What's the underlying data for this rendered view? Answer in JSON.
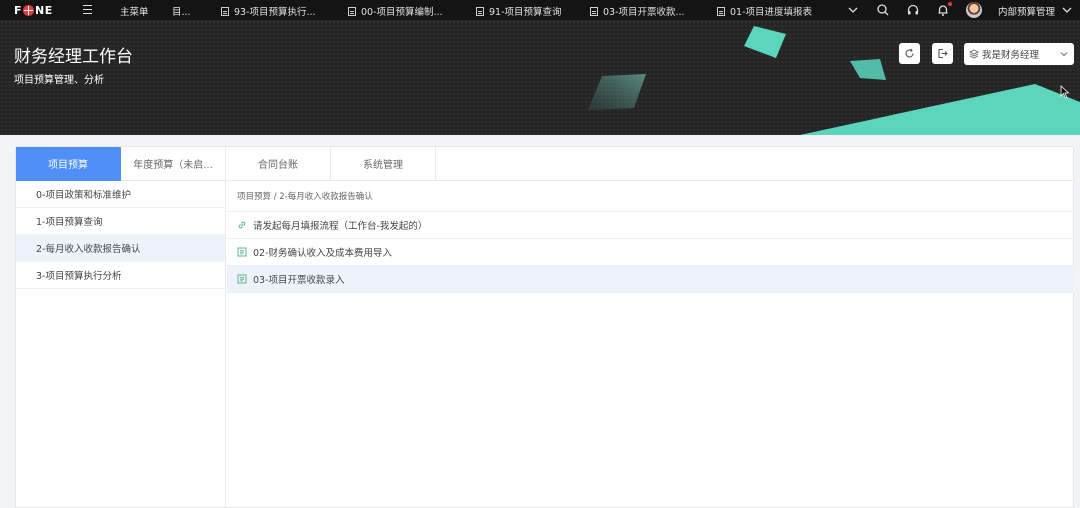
{
  "topbar": {
    "logo": [
      "F",
      "NE"
    ],
    "main_menu": "主菜单",
    "truncated_menu": "目...",
    "tabs": [
      {
        "label": "93-项目预算执行..."
      },
      {
        "label": "00-项目预算编制..."
      },
      {
        "label": "91-项目预算查询"
      },
      {
        "label": "03-项目开票收款..."
      },
      {
        "label": "01-项目进度填报表"
      }
    ],
    "icons": [
      "search-icon",
      "headset-icon",
      "bell-icon"
    ],
    "user_menu": "内部预算管理"
  },
  "banner": {
    "title": "财务经理工作台",
    "subtitle": "项目预算管理、分析",
    "role_select": "我是财务经理",
    "accent_color": "#5bd6bd"
  },
  "tabs": [
    {
      "label": "项目预算",
      "active": true
    },
    {
      "label": "年度预算（未启..."
    },
    {
      "label": "合同台账"
    },
    {
      "label": "系统管理"
    }
  ],
  "sidebar": {
    "items": [
      {
        "label": "0-项目政策和标准维护"
      },
      {
        "label": "1-项目预算查询"
      },
      {
        "label": "2-每月收入收款报告确认",
        "active": true
      },
      {
        "label": "3-项目预算执行分析"
      }
    ]
  },
  "main": {
    "breadcrumb": "项目预算 / 2-每月收入收款报告确认",
    "items": [
      {
        "label": "请发起每月填报流程（工作台-我发起的）",
        "icon": "link-icon"
      },
      {
        "label": "02-财务确认收入及成本费用导入",
        "icon": "form-icon"
      },
      {
        "label": "03-项目开票收款录入",
        "icon": "form-icon",
        "active": true
      }
    ]
  },
  "colors": {
    "active_tab": "#4f8ff7",
    "active_row": "#eef3fb"
  }
}
